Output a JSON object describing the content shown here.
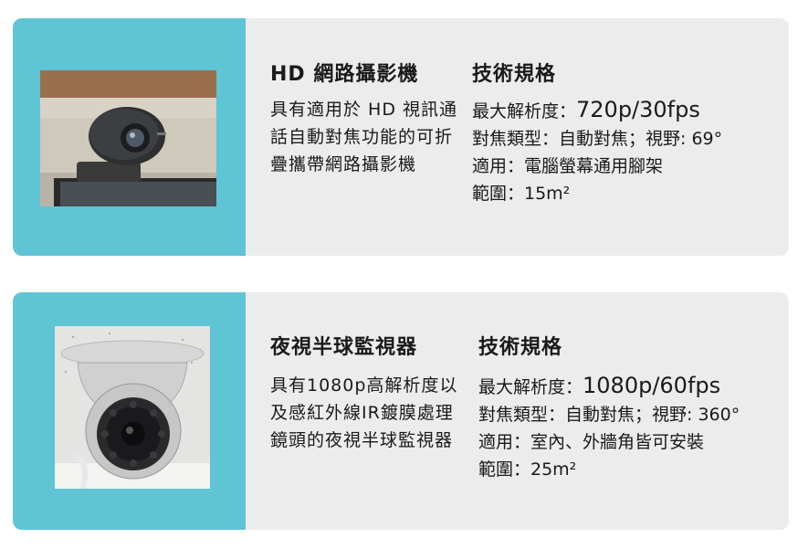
{
  "cards": [
    {
      "title": "HD 網路攝影機",
      "spec_heading": "技術規格",
      "description": "具有適用於 HD 視訊通話自動對焦功能的可折疊攜帶網路攝影機",
      "specs": {
        "resolution_label": "最大解析度：",
        "resolution_value": "720p/30fps",
        "focus_line": "對焦類型：自動對焦；視野: 69°",
        "usage_line": "適用：電腦螢幕通用腳架",
        "range_line": "範圍：15m²"
      },
      "image": "webcam-photo"
    },
    {
      "title": "夜視半球監視器",
      "spec_heading": "技術規格",
      "description": "具有1080p高解析度以及感紅外線IR鍍膜處理鏡頭的夜視半球監視器",
      "specs": {
        "resolution_label": "最大解析度：",
        "resolution_value": "1080p/60fps",
        "focus_line": "對焦類型：自動對焦；視野: 360°",
        "usage_line": "適用：室內、外牆角皆可安裝",
        "range_line": "範圍：25m²"
      },
      "image": "dome-camera-photo"
    }
  ],
  "colors": {
    "accent": "#5fc4d4",
    "card_background": "#ececec"
  }
}
